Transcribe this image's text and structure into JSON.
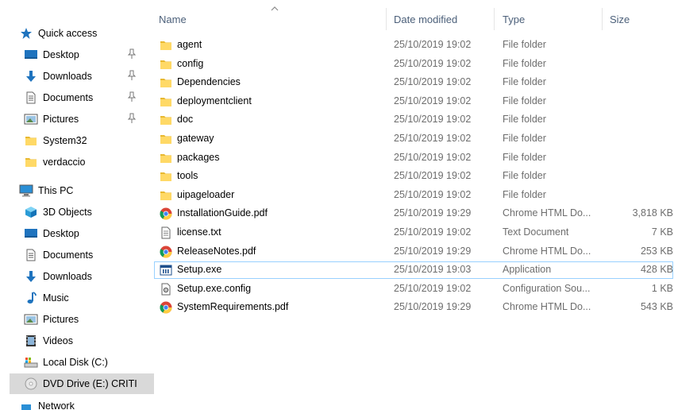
{
  "nav": {
    "quick_access": "Quick access",
    "quick_items": [
      {
        "label": "Desktop",
        "icon": "desktop-icon",
        "pinned": true
      },
      {
        "label": "Downloads",
        "icon": "downloads-icon",
        "pinned": true
      },
      {
        "label": "Documents",
        "icon": "documents-icon",
        "pinned": true
      },
      {
        "label": "Pictures",
        "icon": "pictures-icon",
        "pinned": true
      },
      {
        "label": "System32",
        "icon": "folder-icon",
        "pinned": false
      },
      {
        "label": "verdaccio",
        "icon": "folder-icon",
        "pinned": false
      }
    ],
    "this_pc": "This PC",
    "pc_items": [
      {
        "label": "3D Objects",
        "icon": "3d-objects-icon"
      },
      {
        "label": "Desktop",
        "icon": "desktop-icon"
      },
      {
        "label": "Documents",
        "icon": "documents-icon"
      },
      {
        "label": "Downloads",
        "icon": "downloads-icon"
      },
      {
        "label": "Music",
        "icon": "music-icon"
      },
      {
        "label": "Pictures",
        "icon": "pictures-icon"
      },
      {
        "label": "Videos",
        "icon": "videos-icon"
      },
      {
        "label": "Local Disk (C:)",
        "icon": "local-disk-icon"
      },
      {
        "label": "DVD Drive (E:) CRITI",
        "icon": "dvd-drive-icon",
        "selected": true
      }
    ],
    "network_partial": "Network"
  },
  "columns": {
    "name": "Name",
    "date": "Date modified",
    "type": "Type",
    "size": "Size"
  },
  "files": [
    {
      "name": "agent",
      "date": "25/10/2019 19:02",
      "type": "File folder",
      "size": "",
      "icon": "folder-icon"
    },
    {
      "name": "config",
      "date": "25/10/2019 19:02",
      "type": "File folder",
      "size": "",
      "icon": "folder-icon"
    },
    {
      "name": "Dependencies",
      "date": "25/10/2019 19:02",
      "type": "File folder",
      "size": "",
      "icon": "folder-icon"
    },
    {
      "name": "deploymentclient",
      "date": "25/10/2019 19:02",
      "type": "File folder",
      "size": "",
      "icon": "folder-icon"
    },
    {
      "name": "doc",
      "date": "25/10/2019 19:02",
      "type": "File folder",
      "size": "",
      "icon": "folder-icon"
    },
    {
      "name": "gateway",
      "date": "25/10/2019 19:02",
      "type": "File folder",
      "size": "",
      "icon": "folder-icon"
    },
    {
      "name": "packages",
      "date": "25/10/2019 19:02",
      "type": "File folder",
      "size": "",
      "icon": "folder-icon"
    },
    {
      "name": "tools",
      "date": "25/10/2019 19:02",
      "type": "File folder",
      "size": "",
      "icon": "folder-icon"
    },
    {
      "name": "uipageloader",
      "date": "25/10/2019 19:02",
      "type": "File folder",
      "size": "",
      "icon": "folder-icon"
    },
    {
      "name": "InstallationGuide.pdf",
      "date": "25/10/2019 19:29",
      "type": "Chrome HTML Do...",
      "size": "3,818 KB",
      "icon": "chrome-icon"
    },
    {
      "name": "license.txt",
      "date": "25/10/2019 19:02",
      "type": "Text Document",
      "size": "7 KB",
      "icon": "text-file-icon"
    },
    {
      "name": "ReleaseNotes.pdf",
      "date": "25/10/2019 19:29",
      "type": "Chrome HTML Do...",
      "size": "253 KB",
      "icon": "chrome-icon"
    },
    {
      "name": "Setup.exe",
      "date": "25/10/2019 19:03",
      "type": "Application",
      "size": "428 KB",
      "icon": "application-icon",
      "focused": true
    },
    {
      "name": "Setup.exe.config",
      "date": "25/10/2019 19:02",
      "type": "Configuration Sou...",
      "size": "1 KB",
      "icon": "config-file-icon"
    },
    {
      "name": "SystemRequirements.pdf",
      "date": "25/10/2019 19:29",
      "type": "Chrome HTML Do...",
      "size": "543 KB",
      "icon": "chrome-icon"
    }
  ],
  "colors": {
    "folder": "#ffd966",
    "accent": "#0078d7",
    "header_text": "#4c607a",
    "meta_text": "#6d6d6d",
    "selected_bg": "#d9d9d9",
    "focus_border": "#99d1ff"
  }
}
